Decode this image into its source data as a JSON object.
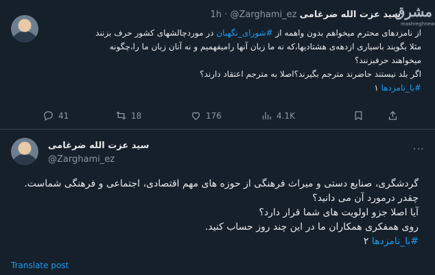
{
  "tweet1": {
    "display_name": "سید عزت الله ضرغامی",
    "handle": "@Zarghami_ez",
    "separator": "·",
    "time": "1h",
    "text_line1_a": "از نامزدهای محترم میخواهم بدون واهمه از",
    "hashtag1": "#شورای_نگهبان",
    "text_line1_b": "در موردچالشهای کشور حرف بزنند",
    "text_line2": "مثلا بگویند باسیاری ازدهه‌ی هشتادیها،که نه ما زبان آنها رامیفهمیم و نه آنان زبان ما را،چگونه",
    "text_line3": "میخواهند حرفبزنند؟",
    "text_line4": "اگر بلد نیستند حاضرند مترجم بگیرند؟اصلا به مترجم اعتقاد دارند؟",
    "hashtag2": "#با_نامزدها",
    "hashtag2_suffix": "۱",
    "actions": {
      "replies": "41",
      "retweets": "18",
      "likes": "176",
      "views": "4.1K"
    }
  },
  "tweet2": {
    "display_name": "سید عزت الله ضرغامی",
    "handle": "@Zarghami_ez",
    "more": "···",
    "line1": "گردشگری، صنایع دستی و میراث فرهنگی از حوزه های مهم اقتصادی، اجتماعی و فرهنگی شماست.",
    "line2": "چقدر درمورد آن می دانید؟",
    "line3": "آیا اصلا جزو اولویت های شما قرار دارد؟",
    "line4": "روی همفکری همکاران ما در این چند روز حساب کنید.",
    "hashtag": "#با_نامزدها",
    "hashtag_suffix": "۲",
    "translate": "Translate post"
  },
  "watermark": {
    "logo_text": "مشرق",
    "url": "mashreghnews.ir"
  },
  "colors": {
    "background": "#15202b",
    "text": "#e7e9ea",
    "muted": "#8b98a5",
    "link": "#1d9bf0"
  }
}
